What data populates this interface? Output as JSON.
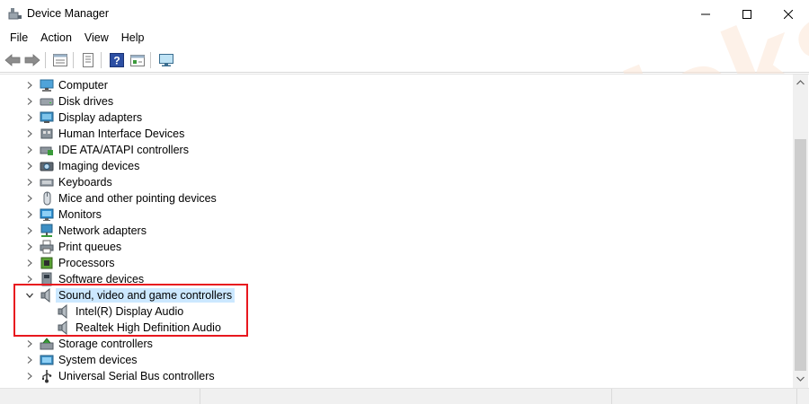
{
  "window": {
    "title": "Device Manager"
  },
  "menu": {
    "items": [
      "File",
      "Action",
      "View",
      "Help"
    ]
  },
  "toolbar": {
    "buttons": [
      "back-icon",
      "forward-icon",
      "properties-view-icon",
      "device-list-icon",
      "help-icon",
      "update-driver-icon",
      "scan-hardware-icon"
    ]
  },
  "tree": {
    "items": [
      {
        "label": "Computer",
        "icon": "computer-icon",
        "expanded": false
      },
      {
        "label": "Disk drives",
        "icon": "disk-drive-icon",
        "expanded": false
      },
      {
        "label": "Display adapters",
        "icon": "display-adapter-icon",
        "expanded": false
      },
      {
        "label": "Human Interface Devices",
        "icon": "hid-icon",
        "expanded": false
      },
      {
        "label": "IDE ATA/ATAPI controllers",
        "icon": "ide-controller-icon",
        "expanded": false
      },
      {
        "label": "Imaging devices",
        "icon": "camera-icon",
        "expanded": false
      },
      {
        "label": "Keyboards",
        "icon": "keyboard-icon",
        "expanded": false
      },
      {
        "label": "Mice and other pointing devices",
        "icon": "mouse-icon",
        "expanded": false
      },
      {
        "label": "Monitors",
        "icon": "monitor-icon",
        "expanded": false
      },
      {
        "label": "Network adapters",
        "icon": "network-adapter-icon",
        "expanded": false
      },
      {
        "label": "Print queues",
        "icon": "printer-icon",
        "expanded": false
      },
      {
        "label": "Processors",
        "icon": "processor-icon",
        "expanded": false
      },
      {
        "label": "Software devices",
        "icon": "software-device-icon",
        "expanded": false
      },
      {
        "label": "Sound, video and game controllers",
        "icon": "speaker-icon",
        "expanded": true,
        "selected": true,
        "children": [
          "Intel(R) Display Audio",
          "Realtek High Definition Audio"
        ]
      },
      {
        "label": "Storage controllers",
        "icon": "storage-controller-icon",
        "expanded": false
      },
      {
        "label": "System devices",
        "icon": "system-device-icon",
        "expanded": false
      },
      {
        "label": "Universal Serial Bus controllers",
        "icon": "usb-icon",
        "expanded": false
      }
    ]
  },
  "watermark": {
    "text": "DeviceTricks"
  }
}
